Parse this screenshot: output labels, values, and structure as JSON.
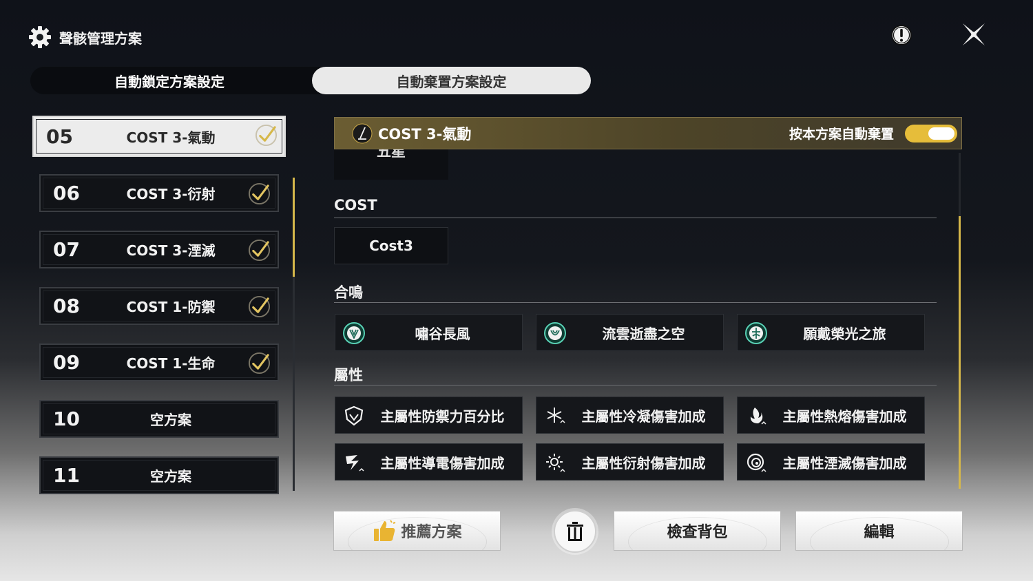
{
  "header": {
    "title": "聲骸管理方案",
    "icons": {
      "settings": "gear-icon",
      "info": "exclamation-icon",
      "close": "close-x-icon"
    }
  },
  "tabs": [
    {
      "label": "自動鎖定方案設定",
      "active": false
    },
    {
      "label": "自動棄置方案設定",
      "active": true
    }
  ],
  "presets": [
    {
      "num": "05",
      "name": "COST 3-氣動",
      "checked": true,
      "active": true
    },
    {
      "num": "06",
      "name": "COST 3-衍射",
      "checked": true,
      "active": false
    },
    {
      "num": "07",
      "name": "COST 3-湮滅",
      "checked": true,
      "active": false
    },
    {
      "num": "08",
      "name": "COST 1-防禦",
      "checked": true,
      "active": false
    },
    {
      "num": "09",
      "name": "COST 1-生命",
      "checked": true,
      "active": false
    },
    {
      "num": "10",
      "name": "空方案",
      "checked": false,
      "active": false
    },
    {
      "num": "11",
      "name": "空方案",
      "checked": false,
      "active": false
    }
  ],
  "scheme": {
    "title": "COST 3-氣動",
    "auto_discard_label": "按本方案自動棄置",
    "auto_discard_on": true,
    "partial_chip": "五星"
  },
  "sections": {
    "cost": {
      "label": "COST",
      "chips": [
        "Cost3"
      ]
    },
    "sonata": {
      "label": "合鳴",
      "chips": [
        {
          "label": "嘯谷長風",
          "icon": "sonata-aero-icon"
        },
        {
          "label": "流雲逝盡之空",
          "icon": "sonata-cloud-icon"
        },
        {
          "label": "願戴榮光之旅",
          "icon": "sonata-glory-icon"
        }
      ]
    },
    "attribute": {
      "label": "屬性",
      "chips": [
        {
          "label": "主屬性防禦力百分比",
          "icon": "shield-icon"
        },
        {
          "label": "主屬性冷凝傷害加成",
          "icon": "snowflake-icon"
        },
        {
          "label": "主屬性熱熔傷害加成",
          "icon": "flame-icon"
        },
        {
          "label": "主屬性導電傷害加成",
          "icon": "lightning-icon"
        },
        {
          "label": "主屬性衍射傷害加成",
          "icon": "sun-icon"
        },
        {
          "label": "主屬性湮滅傷害加成",
          "icon": "vortex-icon"
        }
      ]
    }
  },
  "buttons": {
    "recommend": "推薦方案",
    "check_bag": "檢查背包",
    "edit": "編輯"
  },
  "colors": {
    "accent": "#e6bd3a",
    "header_bar": "#5a4f2e",
    "sonata_teal": "#58d0b4"
  }
}
